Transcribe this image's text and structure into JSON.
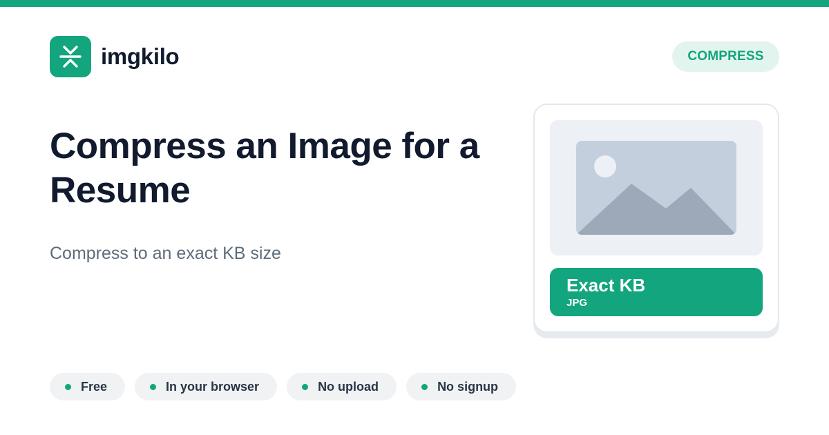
{
  "brand": {
    "name": "imgkilo",
    "icon": "compress-arrows-icon",
    "accent_color": "#13a57d"
  },
  "badge": {
    "label": "COMPRESS"
  },
  "hero": {
    "title": "Compress an Image for a Resume",
    "subtitle": "Compress to an exact KB size"
  },
  "preview": {
    "icon": "image-placeholder-icon",
    "result_title": "Exact KB",
    "result_format": "JPG"
  },
  "features": [
    {
      "label": "Free"
    },
    {
      "label": "In your browser"
    },
    {
      "label": "No upload"
    },
    {
      "label": "No signup"
    }
  ]
}
